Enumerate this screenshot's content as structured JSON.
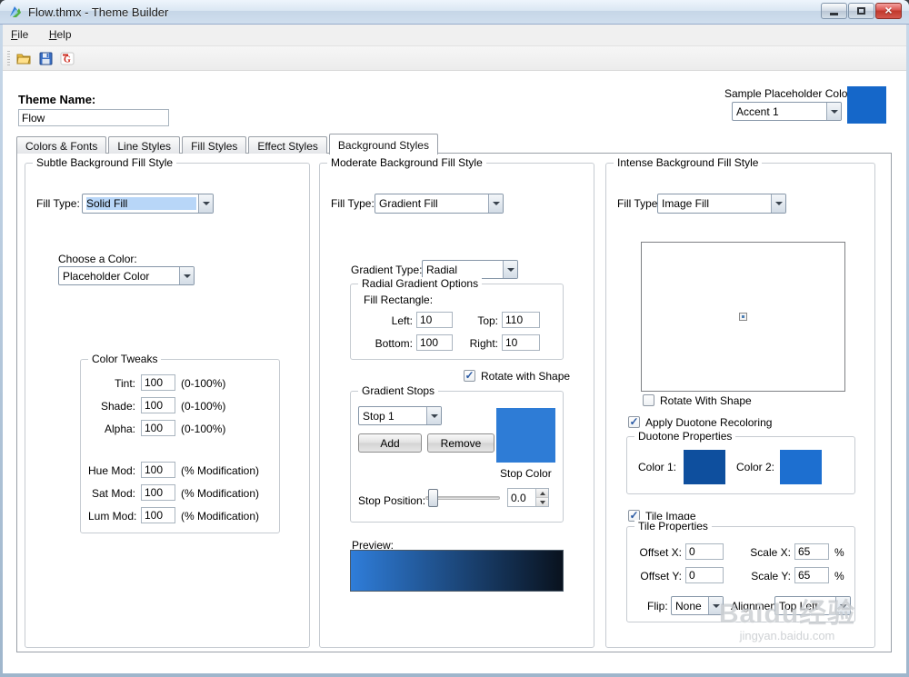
{
  "titlebar": {
    "title": "Flow.thmx - Theme Builder",
    "app_icon": "theme-builder-app-icon",
    "button_icons": [
      "minimize-icon",
      "maximize-icon",
      "close-icon"
    ]
  },
  "menubar": {
    "items": [
      {
        "label": "File"
      },
      {
        "label": "Help"
      }
    ]
  },
  "toolbar": {
    "icons": [
      "open-file-icon",
      "save-icon",
      "app-logo-icon"
    ]
  },
  "header": {
    "theme_name_label": "Theme Name:",
    "theme_name_value": "Flow",
    "placeholder_color_label": "Sample Placeholder Color:",
    "placeholder_color_value": "Accent 1"
  },
  "tabs": [
    {
      "label": "Colors & Fonts"
    },
    {
      "label": "Line Styles"
    },
    {
      "label": "Fill Styles"
    },
    {
      "label": "Effect Styles"
    },
    {
      "label": "Background Styles",
      "active": true
    }
  ],
  "panels": {
    "subtle": {
      "title": "Subtle Background Fill Style",
      "fill_type_label": "Fill Type:",
      "fill_type_value": "Solid Fill",
      "choose_color_label": "Choose a Color:",
      "choose_color_value": "Placeholder Color",
      "tweaks_title": "Color Tweaks",
      "tweaks": [
        {
          "label": "Tint:",
          "value": "100",
          "note": "(0-100%)"
        },
        {
          "label": "Shade:",
          "value": "100",
          "note": "(0-100%)"
        },
        {
          "label": "Alpha:",
          "value": "100",
          "note": "(0-100%)"
        },
        {
          "label": "Hue Mod:",
          "value": "100",
          "note": "(% Modification)"
        },
        {
          "label": "Sat Mod:",
          "value": "100",
          "note": "(% Modification)"
        },
        {
          "label": "Lum Mod:",
          "value": "100",
          "note": "(% Modification)"
        }
      ]
    },
    "moderate": {
      "title": "Moderate Background Fill Style",
      "fill_type_label": "Fill Type:",
      "fill_type_value": "Gradient Fill",
      "gradient_type_label": "Gradient Type:",
      "gradient_type_value": "Radial",
      "radial_title": "Radial Gradient Options",
      "fill_rect_label": "Fill Rectangle:",
      "left_label": "Left:",
      "left_value": "10",
      "top_label": "Top:",
      "top_value": "110",
      "bottom_label": "Bottom:",
      "bottom_value": "100",
      "right_label": "Right:",
      "right_value": "10",
      "rotate_label": "Rotate with Shape",
      "rotate_checked": true,
      "stops_title": "Gradient Stops",
      "stop_select": "Stop 1",
      "add_label": "Add",
      "remove_label": "Remove",
      "stop_color_label": "Stop Color",
      "stop_position_label": "Stop Position:",
      "stop_position_value": "0.0",
      "preview_label": "Preview:"
    },
    "intense": {
      "title": "Intense Background Fill Style",
      "fill_type_label": "Fill Type:",
      "fill_type_value": "Image Fill",
      "rotate_label": "Rotate With Shape",
      "rotate_checked": false,
      "duotone_check": "Apply Duotone Recoloring",
      "duotone_checked": true,
      "duotone_title": "Duotone Properties",
      "color1_label": "Color 1:",
      "color2_label": "Color 2:",
      "tile_check": "Tile Image",
      "tile_checked": true,
      "tile_title": "Tile Properties",
      "offset_x_label": "Offset X:",
      "offset_x_value": "0",
      "offset_y_label": "Offset Y:",
      "offset_y_value": "0",
      "scale_x_label": "Scale X:",
      "scale_x_value": "65",
      "scale_y_label": "Scale Y:",
      "scale_y_value": "65",
      "percent": "%",
      "flip_label": "Flip:",
      "flip_value": "None",
      "align_label": "Alignment:",
      "align_value": "Top Left"
    }
  },
  "watermark": {
    "line1": "Baidu经验",
    "line2": "jingyan.baidu.com"
  },
  "colors": {
    "accent_swatch": "#1567c9",
    "stop_color": "#2e7cd6",
    "duotone1": "#0e4f9e",
    "duotone2": "#1d6fd0",
    "preview_start": "#2f7dd9",
    "preview_end": "#09121e"
  }
}
